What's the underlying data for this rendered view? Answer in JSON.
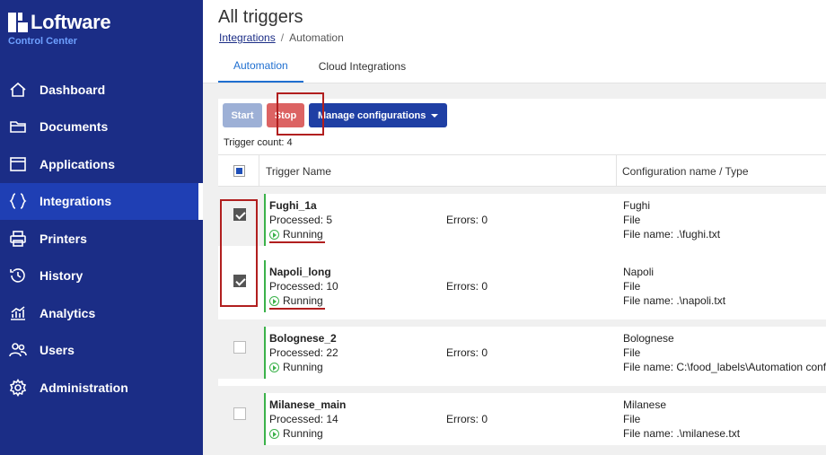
{
  "brand": {
    "name": "Loftware",
    "subtitle": "Control Center"
  },
  "nav": [
    {
      "label": "Dashboard",
      "icon": "home-icon"
    },
    {
      "label": "Documents",
      "icon": "folder-icon"
    },
    {
      "label": "Applications",
      "icon": "window-icon"
    },
    {
      "label": "Integrations",
      "icon": "braces-icon",
      "active": true
    },
    {
      "label": "Printers",
      "icon": "printer-icon"
    },
    {
      "label": "History",
      "icon": "history-icon"
    },
    {
      "label": "Analytics",
      "icon": "analytics-icon"
    },
    {
      "label": "Users",
      "icon": "users-icon"
    },
    {
      "label": "Administration",
      "icon": "gear-icon"
    }
  ],
  "header": {
    "title": "All triggers",
    "breadcrumb": {
      "link": "Integrations",
      "separator": "/",
      "current": "Automation"
    }
  },
  "tabs": [
    {
      "label": "Automation",
      "active": true
    },
    {
      "label": "Cloud Integrations",
      "active": false
    }
  ],
  "toolbar": {
    "start_label": "Start",
    "stop_label": "Stop",
    "manage_label": "Manage configurations"
  },
  "trigger_count": "Trigger count: 4",
  "table": {
    "headers": {
      "name": "Trigger Name",
      "config": "Configuration name / Type"
    },
    "rows": [
      {
        "name": "Fughi_1a",
        "processed": "Processed: 5",
        "status": "Running",
        "errors": "Errors: 0",
        "config_name": "Fughi",
        "config_type": "File",
        "file": "File name: .\\fughi.txt",
        "checked": true
      },
      {
        "name": "Napoli_long",
        "processed": "Processed: 10",
        "status": "Running",
        "errors": "Errors: 0",
        "config_name": "Napoli",
        "config_type": "File",
        "file": "File name: .\\napoli.txt",
        "checked": true
      },
      {
        "name": "Bolognese_2",
        "processed": "Processed: 22",
        "status": "Running",
        "errors": "Errors: 0",
        "config_name": "Bolognese",
        "config_type": "File",
        "file": "File name: C:\\food_labels\\Automation confi",
        "checked": false
      },
      {
        "name": "Milanese_main",
        "processed": "Processed: 14",
        "status": "Running",
        "errors": "Errors: 0",
        "config_name": "Milanese",
        "config_type": "File",
        "file": "File name: .\\milanese.txt",
        "checked": false
      }
    ]
  },
  "colors": {
    "sidebar": "#1b2d86",
    "accent": "#1f6fd0",
    "stop": "#dc6363",
    "running": "#3bb24a",
    "highlight": "#b11f1f"
  }
}
